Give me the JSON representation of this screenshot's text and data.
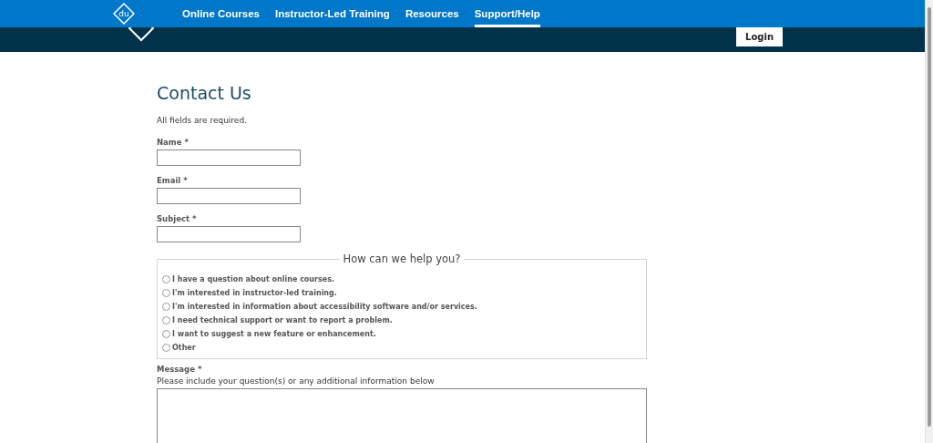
{
  "nav": {
    "logo": "du",
    "items": [
      {
        "label": "Online Courses",
        "selected": false
      },
      {
        "label": "Instructor-Led Training",
        "selected": false
      },
      {
        "label": "Resources",
        "selected": false
      },
      {
        "label": "Support/Help",
        "selected": true
      }
    ]
  },
  "login_button": "Login",
  "page": {
    "title": "Contact Us",
    "intro": "All fields are required.",
    "fields": [
      {
        "label": "Name *"
      },
      {
        "label": "Email *"
      },
      {
        "label": "Subject *"
      }
    ],
    "help": {
      "legend": "How can we help you?",
      "options": [
        {
          "label": "I have a question about online courses.",
          "selected": false
        },
        {
          "label": "I'm interested in instructor-led training.",
          "selected": false
        },
        {
          "label": "I'm interested in information about accessibility software and/or services.",
          "selected": false
        },
        {
          "label": "I need technical support or want to report a problem.",
          "selected": false
        },
        {
          "label": "I want to suggest a new feature or enhancement.",
          "selected": false
        },
        {
          "label": "Other",
          "selected": false
        }
      ]
    },
    "message": {
      "label": "Message *",
      "hint": "Please include your question(s) or any additional information below"
    }
  }
}
